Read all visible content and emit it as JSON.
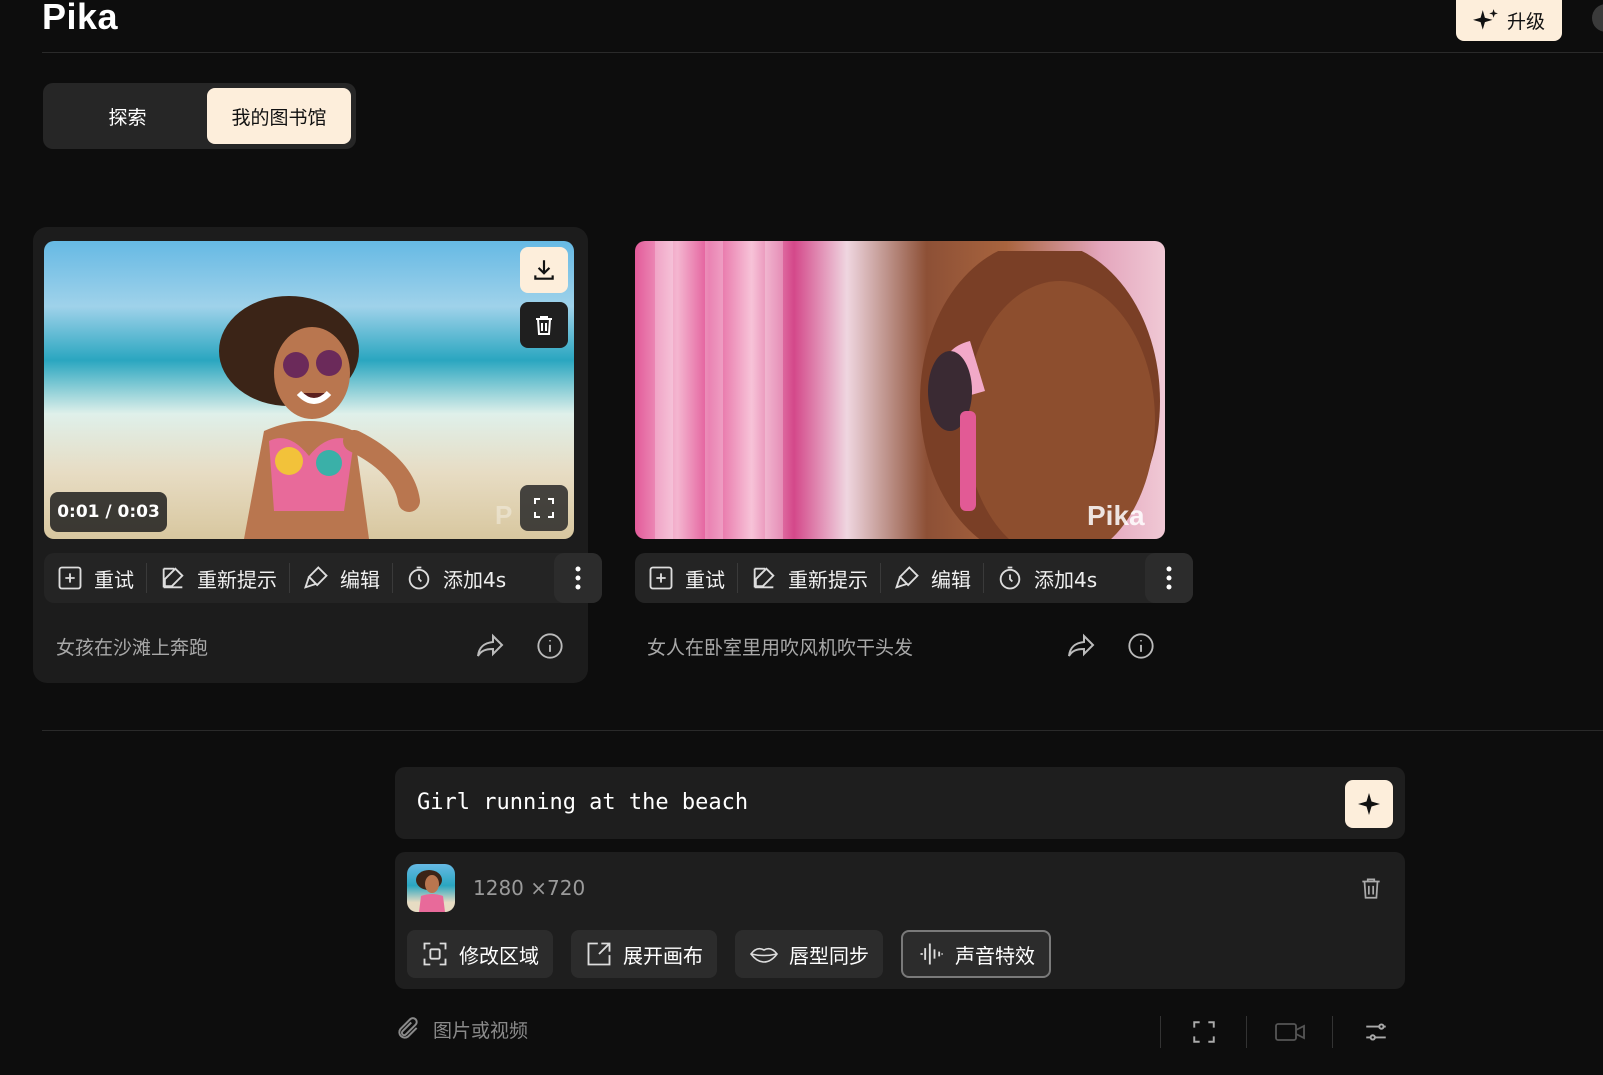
{
  "header": {
    "logo": "Pika",
    "upgrade_label": "升级"
  },
  "tabs": [
    {
      "label": "探索",
      "active": false
    },
    {
      "label": "我的图书馆",
      "active": true
    }
  ],
  "videos": [
    {
      "time": "0:01 / 0:03",
      "watermark": "P",
      "caption": "女孩在沙滩上奔跑",
      "actions": {
        "retry": "重试",
        "reprompt": "重新提示",
        "edit": "编辑",
        "add4s": "添加4s"
      }
    },
    {
      "watermark": "Pika",
      "caption": "女人在卧室里用吹风机吹干头发",
      "actions": {
        "retry": "重试",
        "reprompt": "重新提示",
        "edit": "编辑",
        "add4s": "添加4s"
      }
    }
  ],
  "composer": {
    "prompt": "Girl running at the beach",
    "attachment_dims": "1280 ×720",
    "tools": [
      {
        "label": "修改区域",
        "icon": "region-select-icon"
      },
      {
        "label": "展开画布",
        "icon": "expand-canvas-icon"
      },
      {
        "label": "唇型同步",
        "icon": "lips-icon"
      },
      {
        "label": "声音特效",
        "icon": "sound-wave-icon",
        "active": true
      }
    ],
    "attach_label": "图片或视频"
  },
  "colors": {
    "background": "#0d0d0d",
    "accent": "#fdeedb",
    "card": "#1c1c1c"
  }
}
